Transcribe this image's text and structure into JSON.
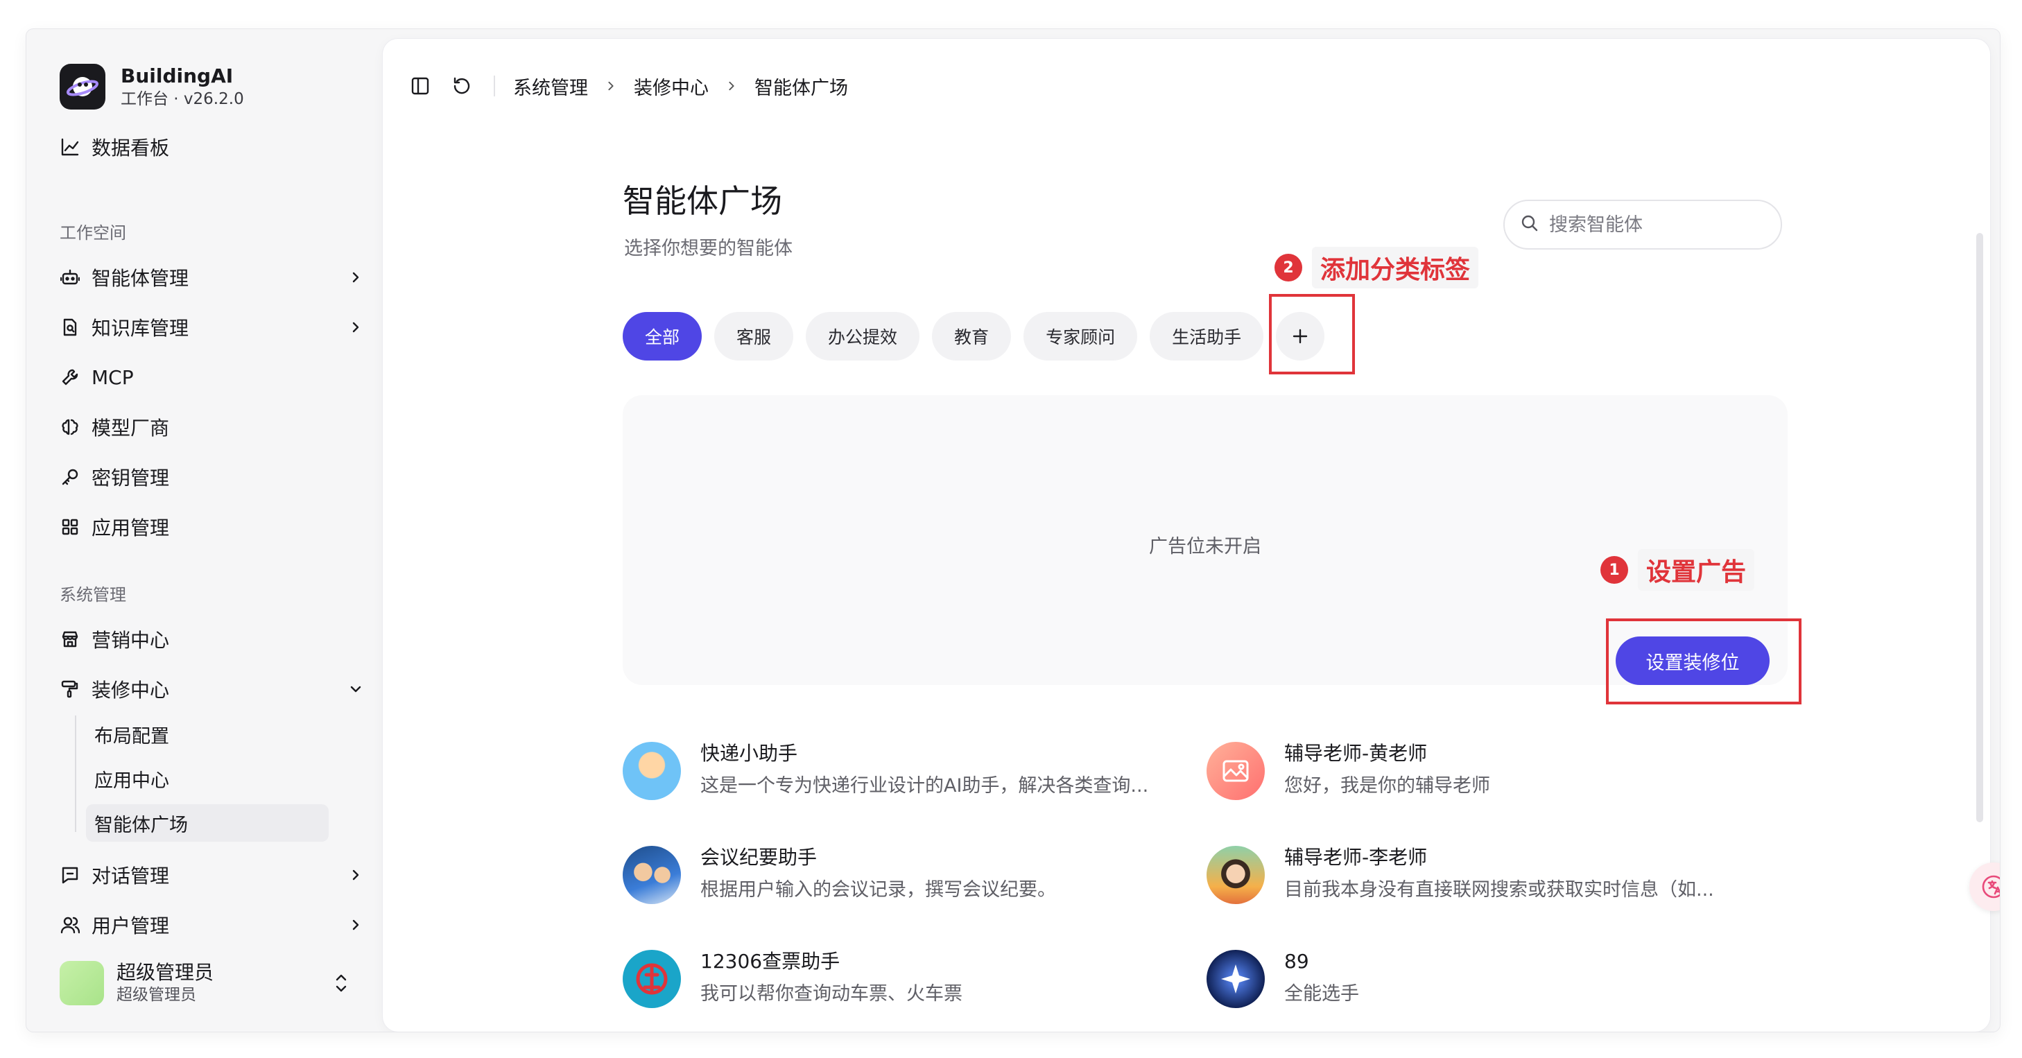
{
  "app": {
    "name": "BuildingAI",
    "subtitle": "工作台 · v26.2.0"
  },
  "sidebar": {
    "dashboard": "数据看板",
    "section_workspace": "工作空间",
    "workspace_items": [
      {
        "label": "智能体管理",
        "icon": "robot-icon"
      },
      {
        "label": "知识库管理",
        "icon": "document-icon"
      },
      {
        "label": "MCP",
        "icon": "wrench-icon"
      },
      {
        "label": "模型厂商",
        "icon": "brain-icon"
      },
      {
        "label": "密钥管理",
        "icon": "key-icon"
      },
      {
        "label": "应用管理",
        "icon": "grid-icon"
      }
    ],
    "section_system": "系统管理",
    "system_items": [
      {
        "label": "营销中心",
        "icon": "store-icon"
      },
      {
        "label": "装修中心",
        "icon": "paint-roller-icon"
      }
    ],
    "decor_subitems": [
      "布局配置",
      "应用中心",
      "智能体广场"
    ],
    "more_items": [
      {
        "label": "对话管理",
        "icon": "chat-icon"
      },
      {
        "label": "用户管理",
        "icon": "users-icon"
      }
    ],
    "user": {
      "name": "超级管理员",
      "role": "超级管理员"
    }
  },
  "breadcrumb": [
    "系统管理",
    "装修中心",
    "智能体广场"
  ],
  "page": {
    "title": "智能体广场",
    "subtitle": "选择你想要的智能体",
    "search_placeholder": "搜索智能体"
  },
  "tabs": [
    "全部",
    "客服",
    "办公提效",
    "教育",
    "专家顾问",
    "生活助手"
  ],
  "ad": {
    "empty_text": "广告位未开启",
    "button_label": "设置装修位"
  },
  "annotations": [
    {
      "num": "1",
      "label": "设置广告"
    },
    {
      "num": "2",
      "label": "添加分类标签"
    }
  ],
  "agents": [
    {
      "name": "快递小助手",
      "desc": "这是一个专为快递行业设计的AI助手，解决各类查询..."
    },
    {
      "name": "辅导老师-黄老师",
      "desc": "您好，我是你的辅导老师"
    },
    {
      "name": "会议纪要助手",
      "desc": "根据用户输入的会议记录，撰写会议纪要。"
    },
    {
      "name": "辅导老师-李老师",
      "desc": "目前我本身没有直接联网搜索或获取实时信息（如..."
    },
    {
      "name": "12306查票助手",
      "desc": "我可以帮你查询动车票、火车票"
    },
    {
      "name": "89",
      "desc": "全能选手"
    }
  ],
  "colors": {
    "accent": "#4f46e5",
    "annotation_red": "#e0343a"
  }
}
